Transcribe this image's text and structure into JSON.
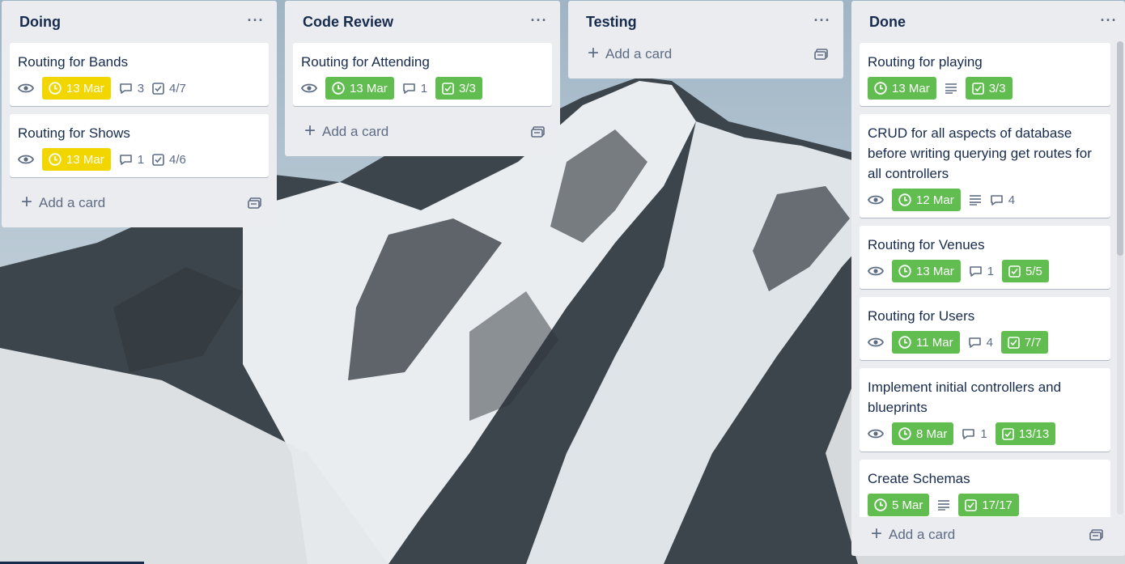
{
  "lists": [
    {
      "title": "Doing",
      "menu": "···",
      "add_card": "Add a card",
      "cards": [
        {
          "title": "Routing for Bands",
          "due": "13 Mar",
          "comments": "3",
          "checklist": "4/7"
        },
        {
          "title": "Routing for Shows",
          "due": "13 Mar",
          "comments": "1",
          "checklist": "4/6"
        }
      ]
    },
    {
      "title": "Code Review",
      "menu": "···",
      "add_card": "Add a card",
      "cards": [
        {
          "title": "Routing for Attending",
          "due": "13 Mar",
          "comments": "1",
          "checklist": "3/3"
        }
      ]
    },
    {
      "title": "Testing",
      "menu": "···",
      "add_card": "Add a card",
      "cards": []
    },
    {
      "title": "Done",
      "menu": "···",
      "add_card": "Add a card",
      "cards": [
        {
          "title": "Routing for playing",
          "due": "13 Mar",
          "checklist": "3/3"
        },
        {
          "title": "CRUD for all aspects of database before writing querying get routes for all controllers",
          "due": "12 Mar",
          "comments": "4"
        },
        {
          "title": "Routing for Venues",
          "due": "13 Mar",
          "comments": "1",
          "checklist": "5/5"
        },
        {
          "title": "Routing for Users",
          "due": "11 Mar",
          "comments": "4",
          "checklist": "7/7"
        },
        {
          "title": "Implement initial controllers and blueprints",
          "due": "8 Mar",
          "comments": "1",
          "checklist": "13/13"
        },
        {
          "title": "Create Schemas",
          "due": "5 Mar",
          "checklist": "17/17"
        }
      ]
    }
  ],
  "colors": {
    "list_bg": "#ebecf0",
    "due_soon": "#f2d600",
    "complete": "#61bd4f",
    "text": "#172b4d",
    "muted": "#5e6c84"
  },
  "icons": [
    "eye-icon",
    "clock-icon",
    "comment-icon",
    "checklist-icon",
    "description-icon",
    "template-icon",
    "plus-icon"
  ]
}
